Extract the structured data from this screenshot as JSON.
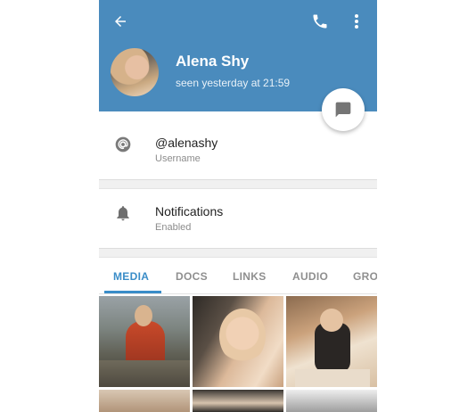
{
  "contact": {
    "name": "Alena Shy",
    "status": "seen yesterday at 21:59"
  },
  "toolbar": {
    "back_icon": "arrow-left-icon",
    "call_icon": "phone-icon",
    "menu_icon": "more-vertical-icon"
  },
  "fab": {
    "icon": "message-icon"
  },
  "info_rows": [
    {
      "icon": "at-icon",
      "title": "@alenashy",
      "subtitle": "Username"
    },
    {
      "icon": "bell-icon",
      "title": "Notifications",
      "subtitle": "Enabled"
    }
  ],
  "tabs": [
    {
      "label": "MEDIA",
      "active": true
    },
    {
      "label": "DOCS",
      "active": false
    },
    {
      "label": "LINKS",
      "active": false
    },
    {
      "label": "AUDIO",
      "active": false
    },
    {
      "label": "GROU",
      "active": false
    }
  ],
  "colors": {
    "header": "#4a8bbd",
    "accent": "#3a8dc8",
    "icon_gray": "#757575"
  }
}
